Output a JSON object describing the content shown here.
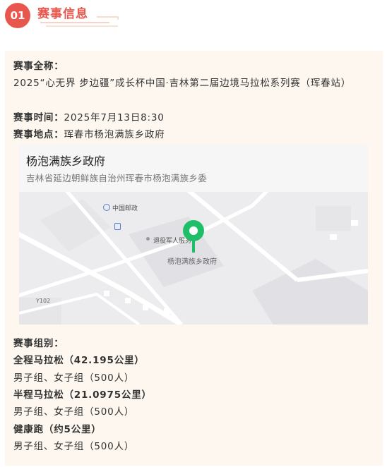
{
  "section": {
    "number": "01",
    "title": "赛事信息"
  },
  "event": {
    "name_label": "赛事全称：",
    "name_value": "2025“心无界 步边疆”成长杯中国·吉林第二届边境马拉松系列赛（珲春站）",
    "time_label": "赛事时间：",
    "time_value": "2025年7月13日8:30",
    "place_label": "赛事地点：",
    "place_value": "珲春市杨泡满族乡政府"
  },
  "map": {
    "place_name": "杨泡满族乡政府",
    "address": "吉林省延边朝鲜族自治州珲春市杨泡满族乡委",
    "labels": {
      "post_office": "中国邮政",
      "veterans_service": "退役军人服务",
      "government": "杨泡满族乡政府",
      "road": "Y102"
    },
    "colors": {
      "pin": "#1fbf6a",
      "road": "#ffffff",
      "block": "#e1e1e5"
    }
  },
  "groups": {
    "label": "赛事组别：",
    "items": [
      {
        "title": "全程马拉松（42.195公里）",
        "detail": "男子组、女子组（500人）"
      },
      {
        "title": "半程马拉松（21.0975公里）",
        "detail": "男子组、女子组（500人）"
      },
      {
        "title": "健康跑（约5公里）",
        "detail": "男子组、女子组（500人）"
      }
    ]
  },
  "colors": {
    "accent": "#e8574d",
    "card_bg": "#fdf7ef"
  }
}
